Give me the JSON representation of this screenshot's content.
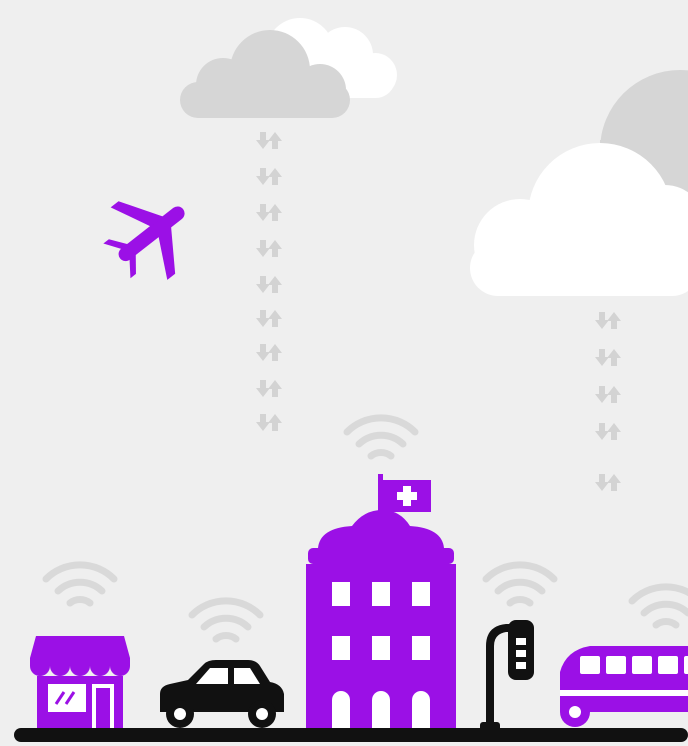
{
  "scene": {
    "background": "#efefef",
    "colors": {
      "accent": "#9b10e6",
      "dark": "#111111",
      "cloud_gray": "#d6d6d6",
      "cloud_white": "#ffffff",
      "signal_gray": "#d9d9d9"
    },
    "icons": [
      "cloud-icon",
      "data-transfer-arrows-icon",
      "airplane-icon",
      "wifi-signal-icon",
      "shop-icon",
      "car-icon",
      "hospital-icon",
      "hospital-flag-icon",
      "street-light-icon",
      "bus-icon",
      "ground-line"
    ]
  }
}
